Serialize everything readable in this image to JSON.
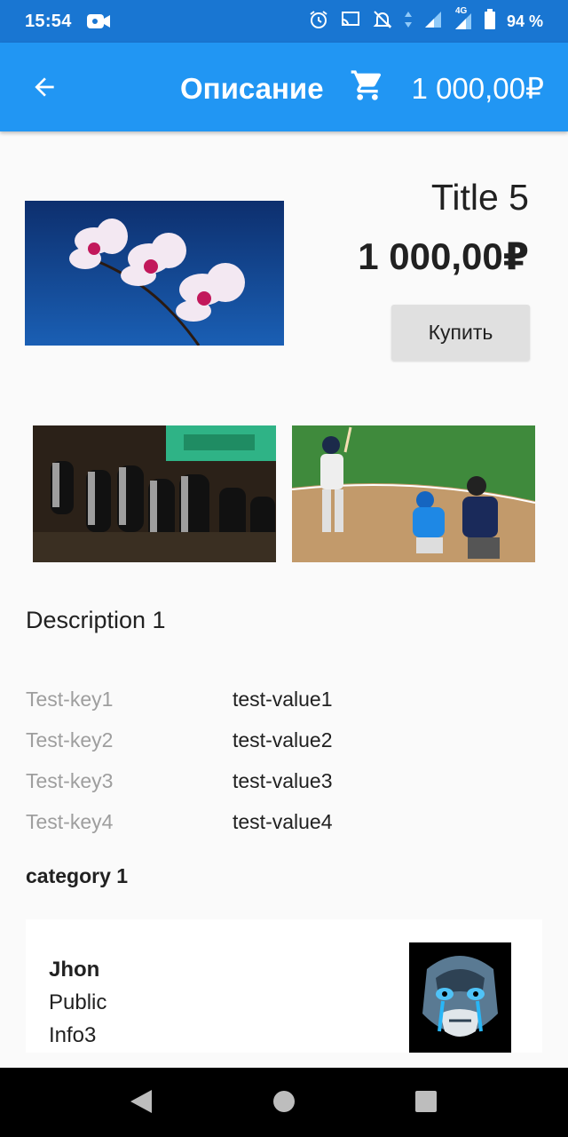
{
  "status_bar": {
    "time": "15:54",
    "battery_percent": "94 %",
    "network": "4G",
    "icons": [
      "video-camera-icon",
      "alarm-icon",
      "cast-icon",
      "notifications-off-icon",
      "signal-icon",
      "battery-icon"
    ]
  },
  "app_bar": {
    "title": "Описание",
    "cart_total": "1 000,00₽",
    "icons": [
      "arrow-back-icon",
      "shopping-cart-icon"
    ],
    "color": "#2196f3"
  },
  "product": {
    "title": "Title 5",
    "price": "1 000,00₽",
    "buy_label": "Купить",
    "description": "Description 1",
    "category": "category 1"
  },
  "properties": [
    {
      "key": "Test-key1",
      "value": "test-value1"
    },
    {
      "key": "Test-key2",
      "value": "test-value2"
    },
    {
      "key": "Test-key3",
      "value": "test-value3"
    },
    {
      "key": "Test-key4",
      "value": "test-value4"
    }
  ],
  "seller": {
    "name": "Jhon",
    "type": "Public",
    "info": "Info3"
  },
  "colors": {
    "status_bar": "#1976d2",
    "app_bar": "#2196f3",
    "background": "#fafafa",
    "button": "#e0e0e0"
  }
}
